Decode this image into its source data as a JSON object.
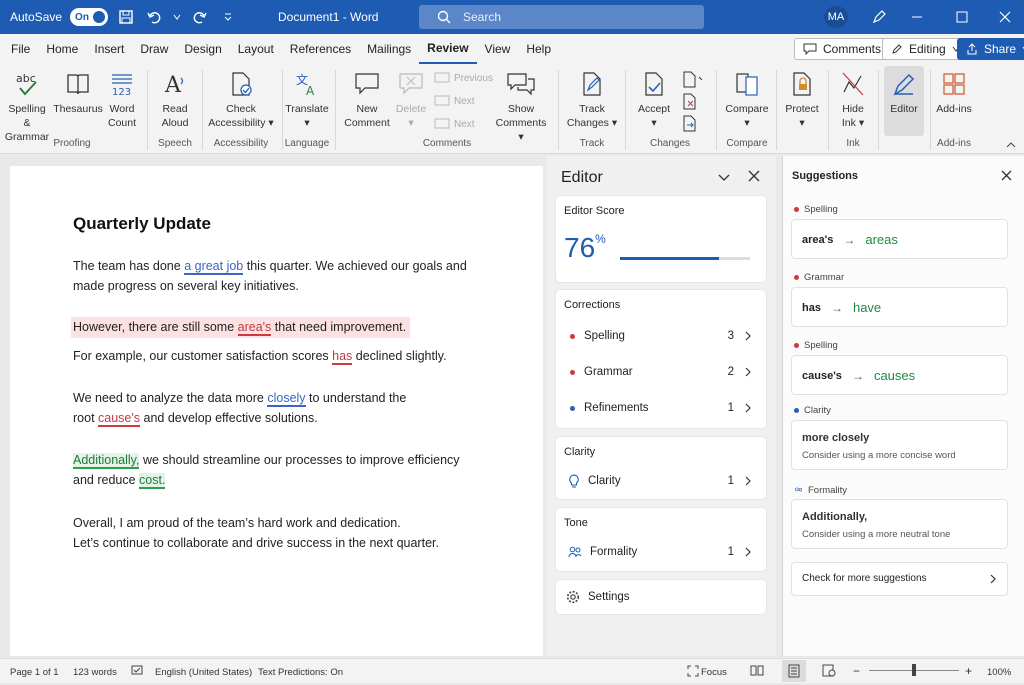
{
  "titlebar": {
    "autosave_label": "AutoSave",
    "autosave_state": "On",
    "doc_title": "Document1  -  Word",
    "search_placeholder": "Search",
    "avatar": "MA"
  },
  "menu": {
    "items": [
      "File",
      "Home",
      "Insert",
      "Draw",
      "Design",
      "Layout",
      "References",
      "Mailings",
      "Review",
      "View",
      "Help"
    ],
    "active": "Review",
    "comments": "Comments",
    "editing": "Editing",
    "share": "Share"
  },
  "ribbon": {
    "spelling": "Spelling &",
    "spelling2": "Grammar",
    "thesaurus": "Thesaurus",
    "wordcount": "Word",
    "wordcount2": "Count",
    "readaloud": "Read",
    "readaloud2": "Aloud",
    "checkacc": "Check",
    "checkacc2": "Accessibility",
    "translate": "Translate",
    "newcomment": "New",
    "newcomment2": "Comment",
    "delete": "Delete",
    "previous": "Previous",
    "next1": "Next",
    "next2": "Next",
    "showcomments": "Show",
    "showcomments2": "Comments",
    "track": "Track",
    "track2": "Changes",
    "accept": "Accept",
    "compare": "Compare",
    "protect": "Protect",
    "hideink": "Hide",
    "hideink2": "Ink",
    "editor": "Editor",
    "addins": "Add-ins",
    "groups": {
      "proofing": "Proofing",
      "speech": "Speech",
      "accessibility": "Accessibility",
      "language": "Language",
      "comments": "Comments",
      "tracking": "Track",
      "changes": "Changes",
      "compare": "Compare",
      "ink": "Ink",
      "addins": "Add-ins"
    }
  },
  "document": {
    "heading": "Quarterly Update",
    "p1a": "The team has done ",
    "p1b": "a great job",
    "p1c": " this quarter. We achieved our goals and",
    "p1d": "made progress on several key initiatives.",
    "p2a": "However, there are still some ",
    "p2b": "area's",
    "p2c": " that need improvement.",
    "p3a": "For example, our customer satisfaction scores ",
    "p3b": "has",
    "p3c": " declined slightly.",
    "p4a": "We need to analyze the data more ",
    "p4b": "closely",
    "p4c": " to understand the",
    "p4d": "root ",
    "p4e": "cause's",
    "p4f": " and develop effective solutions.",
    "p5a": "Additionally,",
    "p5b": " we should streamline our processes to improve efficiency",
    "p5c": "and reduce ",
    "p5d": "cost.",
    "p6a": "Overall, I am proud of the team’s hard work and dedication.",
    "p6b": "Let’s continue to collaborate and drive success in the next quarter."
  },
  "editor": {
    "title": "Editor",
    "score_label": "Editor Score",
    "score": "76",
    "score_unit": "%",
    "score_fraction": 0.76,
    "corrections_label": "Corrections",
    "corrections": [
      {
        "label": "Spelling",
        "count": "3",
        "color": "#d0373f"
      },
      {
        "label": "Grammar",
        "count": "2",
        "color": "#d0373f"
      },
      {
        "label": "Refinements",
        "count": "1",
        "color": "#2a5fb5"
      }
    ],
    "clarity_label": "Clarity",
    "clarity_item": "Clarity",
    "clarity_count": "1",
    "tone_label": "Tone",
    "formality_item": "Formality",
    "formality_count": "1",
    "settings": "Settings"
  },
  "suggestions": {
    "title": "Suggestions",
    "items": [
      {
        "category": "Spelling",
        "from": "area's",
        "to": "areas"
      },
      {
        "category": "Grammar",
        "from": "has",
        "to": "have"
      },
      {
        "category": "Spelling",
        "from": "cause's",
        "to": "causes"
      }
    ],
    "clarity": {
      "category": "Clarity",
      "title": "more closely",
      "desc": "Consider using a more concise word"
    },
    "formality": {
      "category": "Formality",
      "title": "Additionally,",
      "desc": "Consider using a more neutral tone"
    },
    "more": "Check for more suggestions"
  },
  "status": {
    "page": "Page 1 of 1",
    "words": "123 words",
    "language": "English (United States)",
    "predictions": "Text Predictions: On",
    "focus": "Focus",
    "zoom": "100%"
  }
}
